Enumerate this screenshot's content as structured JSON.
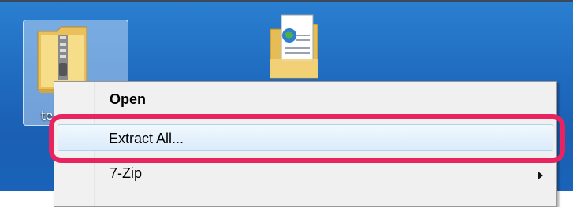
{
  "desktop": {
    "selected_icon_label": "te",
    "icons": [
      {
        "name": "zip-folder-icon"
      },
      {
        "name": "web-document-folder-icon"
      }
    ]
  },
  "context_menu": {
    "items": [
      {
        "label": "Open",
        "default": true
      },
      {
        "label": "Extract All...",
        "hovered": true,
        "highlighted": true
      },
      {
        "label": "7-Zip",
        "has_submenu": true
      }
    ]
  },
  "colors": {
    "desktop_blue": "#1f6bc0",
    "menu_bg": "#f0f0f0",
    "highlight_ring": "#e8235f",
    "hover_border": "#a8d3f5"
  }
}
